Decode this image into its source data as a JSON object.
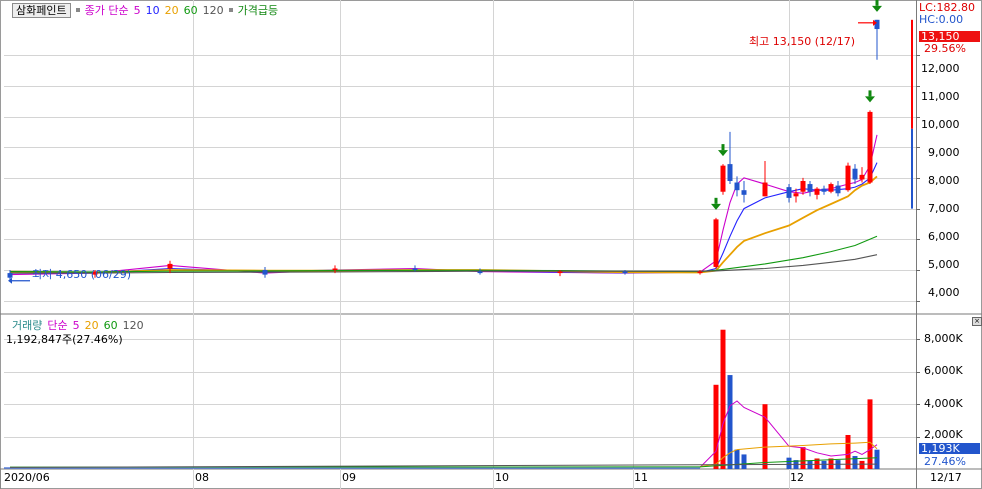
{
  "header": {
    "title": "삼화페인트",
    "price_legend": "종가 단순",
    "ma_periods": [
      "5",
      "10",
      "20",
      "60",
      "120"
    ],
    "ma_colors": [
      "#cc00cc",
      "#2323ff",
      "#e8a000",
      "#119911",
      "#555555"
    ],
    "signal_label": "가격급등"
  },
  "volume_header": {
    "title": "거래량",
    "ma_label": "단순",
    "ma_periods": [
      "5",
      "20",
      "60",
      "120"
    ],
    "ma_colors": [
      "#cc00cc",
      "#e8a000",
      "#119911",
      "#555555"
    ],
    "value_text": "1,192,847주(27.46%)"
  },
  "right_info": {
    "lc": "LC:182.80",
    "hc": "HC:0.00",
    "price_box": "13,150",
    "change_pct": "29.56%",
    "volume_box": "1,193K",
    "volume_pct": "27.46%",
    "last_date": "12/17"
  },
  "annotations": {
    "high": "최고 13,150 (12/17)",
    "low": "최저 4,650 (06/29)"
  },
  "colors": {
    "up": "#ff0000",
    "down": "#2255cc",
    "arrow": "#118811",
    "grid": "#d4d4d4"
  },
  "chart_data": [
    {
      "type": "candlestick",
      "title": "삼화페인트",
      "ylim": [
        3600,
        13600
      ],
      "yticks": [
        4000,
        5000,
        6000,
        7000,
        8000,
        9000,
        10000,
        11000,
        12000
      ],
      "ytick_labels": [
        "4,000",
        "5,000",
        "6,000",
        "7,000",
        "8,000",
        "9,000",
        "10,000",
        "11,000",
        "12,000"
      ],
      "x_labels": [
        "2020/06",
        "08",
        "09",
        "10",
        "11",
        "12",
        "12/17"
      ],
      "moving_averages": [
        "5",
        "10",
        "20",
        "60",
        "120"
      ],
      "candles": [
        {
          "d": "06/29",
          "o": 4900,
          "h": 5000,
          "l": 4650,
          "c": 4750
        },
        {
          "d": "07/15",
          "o": 4850,
          "h": 5000,
          "l": 4750,
          "c": 4950
        },
        {
          "d": "07/30",
          "o": 5050,
          "h": 5300,
          "l": 4900,
          "c": 5200
        },
        {
          "d": "08/14",
          "o": 5000,
          "h": 5100,
          "l": 4750,
          "c": 4850
        },
        {
          "d": "08/31",
          "o": 5000,
          "h": 5150,
          "l": 4900,
          "c": 5050
        },
        {
          "d": "09/15",
          "o": 5050,
          "h": 5150,
          "l": 4950,
          "c": 5000
        },
        {
          "d": "09/29",
          "o": 4950,
          "h": 5050,
          "l": 4850,
          "c": 4900
        },
        {
          "d": "10/15",
          "o": 4900,
          "h": 5000,
          "l": 4800,
          "c": 4950
        },
        {
          "d": "10/30",
          "o": 4950,
          "h": 5000,
          "l": 4850,
          "c": 4900
        },
        {
          "d": "11/13",
          "o": 4900,
          "h": 5000,
          "l": 4850,
          "c": 4950
        },
        {
          "d": "11/20",
          "o": 5100,
          "h": 6700,
          "l": 5050,
          "c": 6650
        },
        {
          "d": "11/23",
          "o": 7550,
          "h": 8450,
          "l": 7450,
          "c": 8400
        },
        {
          "d": "11/24",
          "o": 8450,
          "h": 9500,
          "l": 7800,
          "c": 7900
        },
        {
          "d": "11/25",
          "o": 7850,
          "h": 8050,
          "l": 7400,
          "c": 7600
        },
        {
          "d": "11/26",
          "o": 7600,
          "h": 7900,
          "l": 7200,
          "c": 7450
        },
        {
          "d": "11/27",
          "o": 7400,
          "h": 8550,
          "l": 7400,
          "c": 7850
        },
        {
          "d": "12/01",
          "o": 7700,
          "h": 7800,
          "l": 7200,
          "c": 7350
        },
        {
          "d": "12/02",
          "o": 7400,
          "h": 7650,
          "l": 7200,
          "c": 7500
        },
        {
          "d": "12/03",
          "o": 7550,
          "h": 8000,
          "l": 7450,
          "c": 7900
        },
        {
          "d": "12/04",
          "o": 7800,
          "h": 7900,
          "l": 7400,
          "c": 7550
        },
        {
          "d": "12/07",
          "o": 7450,
          "h": 7700,
          "l": 7300,
          "c": 7650
        },
        {
          "d": "12/08",
          "o": 7650,
          "h": 7750,
          "l": 7450,
          "c": 7550
        },
        {
          "d": "12/09",
          "o": 7550,
          "h": 7850,
          "l": 7500,
          "c": 7800
        },
        {
          "d": "12/10",
          "o": 7750,
          "h": 7900,
          "l": 7400,
          "c": 7500
        },
        {
          "d": "12/11",
          "o": 7600,
          "h": 8500,
          "l": 7550,
          "c": 8400
        },
        {
          "d": "12/14",
          "o": 8300,
          "h": 8450,
          "l": 7800,
          "c": 7950
        },
        {
          "d": "12/15",
          "o": 7950,
          "h": 8350,
          "l": 7850,
          "c": 8100
        },
        {
          "d": "12/16",
          "o": 7850,
          "h": 10200,
          "l": 7800,
          "c": 10150
        },
        {
          "d": "12/17",
          "o": 13150,
          "h": 13150,
          "l": 11850,
          "c": 12850
        }
      ],
      "lines": [
        {
          "name": "5",
          "points": [
            [
              "06/29",
              4850
            ],
            [
              "07/15",
              4900
            ],
            [
              "07/30",
              5150
            ],
            [
              "08/14",
              4900
            ],
            [
              "08/31",
              5000
            ],
            [
              "09/15",
              5050
            ],
            [
              "09/29",
              4950
            ],
            [
              "10/15",
              4920
            ],
            [
              "10/30",
              4900
            ],
            [
              "11/13",
              4930
            ],
            [
              "11/20",
              5300
            ],
            [
              "11/23",
              6300
            ],
            [
              "11/24",
              7200
            ],
            [
              "11/25",
              7800
            ],
            [
              "11/26",
              8000
            ],
            [
              "11/27",
              7800
            ],
            [
              "12/01",
              7550
            ],
            [
              "12/03",
              7500
            ],
            [
              "12/07",
              7600
            ],
            [
              "12/09",
              7650
            ],
            [
              "12/11",
              7800
            ],
            [
              "12/14",
              7850
            ],
            [
              "12/15",
              7950
            ],
            [
              "12/16",
              8400
            ],
            [
              "12/17",
              9400
            ]
          ]
        },
        {
          "name": "10",
          "points": [
            [
              "06/29",
              4900
            ],
            [
              "07/15",
              4900
            ],
            [
              "07/30",
              5050
            ],
            [
              "08/14",
              4950
            ],
            [
              "08/31",
              5000
            ],
            [
              "09/15",
              5000
            ],
            [
              "09/29",
              4980
            ],
            [
              "10/15",
              4930
            ],
            [
              "10/30",
              4910
            ],
            [
              "11/13",
              4920
            ],
            [
              "11/20",
              5050
            ],
            [
              "11/23",
              5550
            ],
            [
              "11/24",
              6100
            ],
            [
              "11/25",
              6600
            ],
            [
              "11/26",
              7000
            ],
            [
              "11/27",
              7350
            ],
            [
              "12/01",
              7550
            ],
            [
              "12/03",
              7650
            ],
            [
              "12/07",
              7600
            ],
            [
              "12/09",
              7600
            ],
            [
              "12/11",
              7650
            ],
            [
              "12/14",
              7700
            ],
            [
              "12/15",
              7800
            ],
            [
              "12/16",
              8000
            ],
            [
              "12/17",
              8500
            ]
          ]
        },
        {
          "name": "20",
          "points": [
            [
              "06/29",
              4950
            ],
            [
              "07/15",
              4920
            ],
            [
              "07/30",
              5000
            ],
            [
              "08/14",
              4980
            ],
            [
              "08/31",
              4980
            ],
            [
              "09/15",
              5000
            ],
            [
              "09/29",
              5000
            ],
            [
              "10/15",
              4960
            ],
            [
              "10/30",
              4930
            ],
            [
              "11/13",
              4920
            ],
            [
              "11/20",
              4980
            ],
            [
              "11/23",
              5250
            ],
            [
              "11/24",
              5500
            ],
            [
              "11/25",
              5750
            ],
            [
              "11/26",
              5950
            ],
            [
              "11/27",
              6200
            ],
            [
              "12/01",
              6450
            ],
            [
              "12/03",
              6700
            ],
            [
              "12/07",
              6950
            ],
            [
              "12/09",
              7150
            ],
            [
              "12/11",
              7400
            ],
            [
              "12/14",
              7600
            ],
            [
              "12/15",
              7750
            ],
            [
              "12/16",
              7850
            ],
            [
              "12/17",
              8050
            ]
          ]
        },
        {
          "name": "60",
          "points": [
            [
              "06/29",
              4950
            ],
            [
              "07/15",
              4940
            ],
            [
              "07/30",
              4960
            ],
            [
              "08/14",
              4970
            ],
            [
              "08/31",
              4980
            ],
            [
              "09/15",
              4990
            ],
            [
              "09/29",
              4990
            ],
            [
              "10/15",
              4980
            ],
            [
              "10/30",
              4960
            ],
            [
              "11/13",
              4950
            ],
            [
              "11/20",
              4990
            ],
            [
              "11/27",
              5200
            ],
            [
              "12/03",
              5400
            ],
            [
              "12/09",
              5600
            ],
            [
              "12/14",
              5800
            ],
            [
              "12/17",
              6100
            ]
          ]
        },
        {
          "name": "120",
          "points": [
            [
              "06/29",
              4900
            ],
            [
              "07/15",
              4900
            ],
            [
              "07/30",
              4920
            ],
            [
              "08/14",
              4930
            ],
            [
              "08/31",
              4940
            ],
            [
              "09/15",
              4950
            ],
            [
              "09/29",
              4960
            ],
            [
              "10/15",
              4960
            ],
            [
              "10/30",
              4960
            ],
            [
              "11/13",
              4960
            ],
            [
              "11/20",
              4970
            ],
            [
              "11/27",
              5050
            ],
            [
              "12/03",
              5150
            ],
            [
              "12/09",
              5250
            ],
            [
              "12/14",
              5350
            ],
            [
              "12/17",
              5500
            ]
          ]
        }
      ],
      "signals": [
        "11/20",
        "11/23",
        "12/16",
        "12/17"
      ]
    },
    {
      "type": "bar",
      "title": "거래량",
      "ylim": [
        0,
        9200
      ],
      "unit": "K",
      "yticks": [
        2000,
        4000,
        6000,
        8000
      ],
      "ytick_labels": [
        "2,000K",
        "4,000K",
        "6,000K",
        "8,000K"
      ],
      "categories": [
        "11/20",
        "11/23",
        "11/24",
        "11/25",
        "11/26",
        "11/27",
        "12/01",
        "12/02",
        "12/03",
        "12/04",
        "12/07",
        "12/08",
        "12/09",
        "12/10",
        "12/11",
        "12/14",
        "12/15",
        "12/16",
        "12/17"
      ],
      "values": [
        5200,
        8600,
        5800,
        1200,
        900,
        4000,
        700,
        550,
        1350,
        500,
        650,
        500,
        650,
        550,
        2100,
        800,
        500,
        4300,
        1193
      ],
      "up": [
        true,
        true,
        false,
        false,
        false,
        true,
        false,
        false,
        true,
        false,
        true,
        false,
        true,
        false,
        true,
        false,
        true,
        true,
        false
      ],
      "lines": [
        {
          "name": "5",
          "points": [
            [
              "11/13",
              100
            ],
            [
              "11/20",
              1100
            ],
            [
              "11/23",
              2800
            ],
            [
              "11/24",
              3900
            ],
            [
              "11/25",
              4200
            ],
            [
              "11/26",
              3800
            ],
            [
              "11/27",
              3200
            ],
            [
              "12/01",
              1400
            ],
            [
              "12/03",
              1300
            ],
            [
              "12/07",
              1000
            ],
            [
              "12/09",
              800
            ],
            [
              "12/11",
              900
            ],
            [
              "12/14",
              1100
            ],
            [
              "12/15",
              900
            ],
            [
              "12/16",
              1200
            ],
            [
              "12/17",
              1500
            ]
          ]
        },
        {
          "name": "20",
          "points": [
            [
              "11/13",
              150
            ],
            [
              "11/20",
              300
            ],
            [
              "11/23",
              700
            ],
            [
              "11/24",
              1000
            ],
            [
              "11/25",
              1200
            ],
            [
              "11/27",
              1350
            ],
            [
              "12/03",
              1450
            ],
            [
              "12/09",
              1550
            ],
            [
              "12/14",
              1600
            ],
            [
              "12/16",
              1650
            ],
            [
              "12/17",
              1250
            ]
          ]
        },
        {
          "name": "60",
          "points": [
            [
              "06/29",
              120
            ],
            [
              "11/13",
              130
            ],
            [
              "11/27",
              400
            ],
            [
              "12/17",
              700
            ]
          ]
        },
        {
          "name": "120",
          "points": [
            [
              "06/29",
              100
            ],
            [
              "12/17",
              300
            ]
          ]
        }
      ]
    }
  ]
}
